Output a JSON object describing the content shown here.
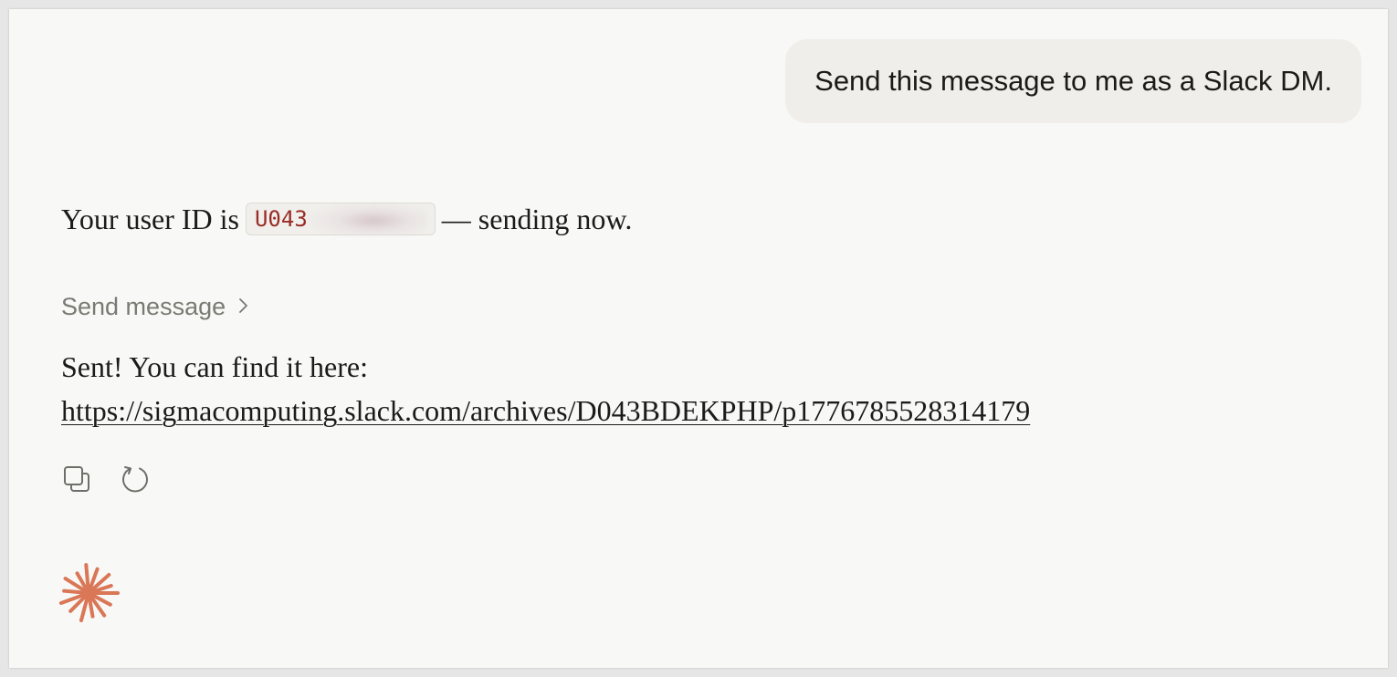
{
  "user_message": {
    "text": "Send this message to me as a Slack DM."
  },
  "assistant": {
    "id_prefix_text": "Your user ID is",
    "user_id_visible": "U043",
    "id_suffix_text": "— sending now.",
    "tool_call_label": "Send message",
    "sent_text": "Sent! You can find it here:",
    "link_url": "https://sigmacomputing.slack.com/archives/D043BDEKPHP/p1776785528314179"
  },
  "icons": {
    "copy": "copy-icon",
    "retry": "retry-icon",
    "tool_chevron": "chevron-right-icon",
    "logo": "claude-spark-icon"
  },
  "colors": {
    "accent": "#d97757",
    "code_text": "#9a2c27",
    "muted": "#7a7a74"
  }
}
